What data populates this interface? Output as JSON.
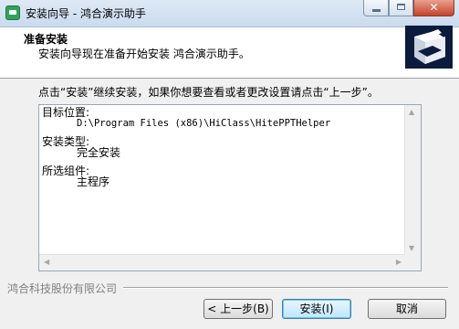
{
  "window": {
    "title": "安装向导 - 鸿合演示助手",
    "close_glyph": "✕"
  },
  "header": {
    "title": "准备安装",
    "subtitle": "安装向导现在准备开始安装 鸿合演示助手。"
  },
  "body": {
    "intro": "点击“安装”继续安装，如果你想要查看或者更改设置请点击“上一步”。",
    "memo": {
      "dest_label": "目标位置:",
      "dest_value": "D:\\Program Files (x86)\\HiClass\\HitePPTHelper",
      "type_label": "安装类型:",
      "type_value": "完全安装",
      "components_label": "所选组件:",
      "components_value": "主程序"
    }
  },
  "footer": {
    "company": "鸿合科技股份有限公司"
  },
  "buttons": {
    "back": "< 上一步(B)",
    "install": "安装(I)",
    "cancel": "取消"
  }
}
